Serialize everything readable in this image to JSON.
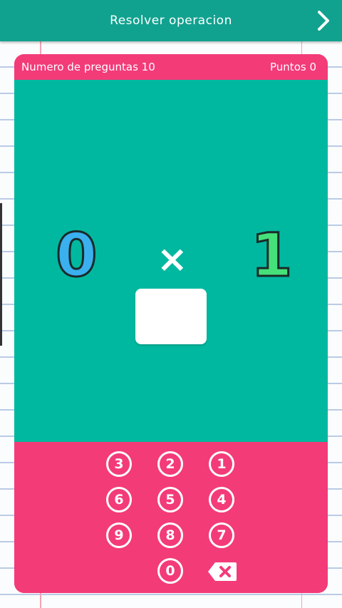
{
  "header": {
    "title": "Resolver operacion"
  },
  "stats": {
    "questions_label": "Numero de preguntas 10",
    "points_label": "Puntos 0"
  },
  "problem": {
    "left_operand": "0",
    "operator": "×",
    "right_operand": "1",
    "answer": ""
  },
  "keypad": {
    "keys": [
      "3",
      "2",
      "1",
      "6",
      "5",
      "4",
      "9",
      "8",
      "7",
      "0"
    ]
  },
  "colors": {
    "header": "#11a28f",
    "board": "#00b89f",
    "accent": "#f33b78",
    "left_operand": "#3bb0ee",
    "right_operand": "#46e07a"
  },
  "icons": {
    "next": "chevron-right-icon",
    "delete": "backspace-icon"
  }
}
